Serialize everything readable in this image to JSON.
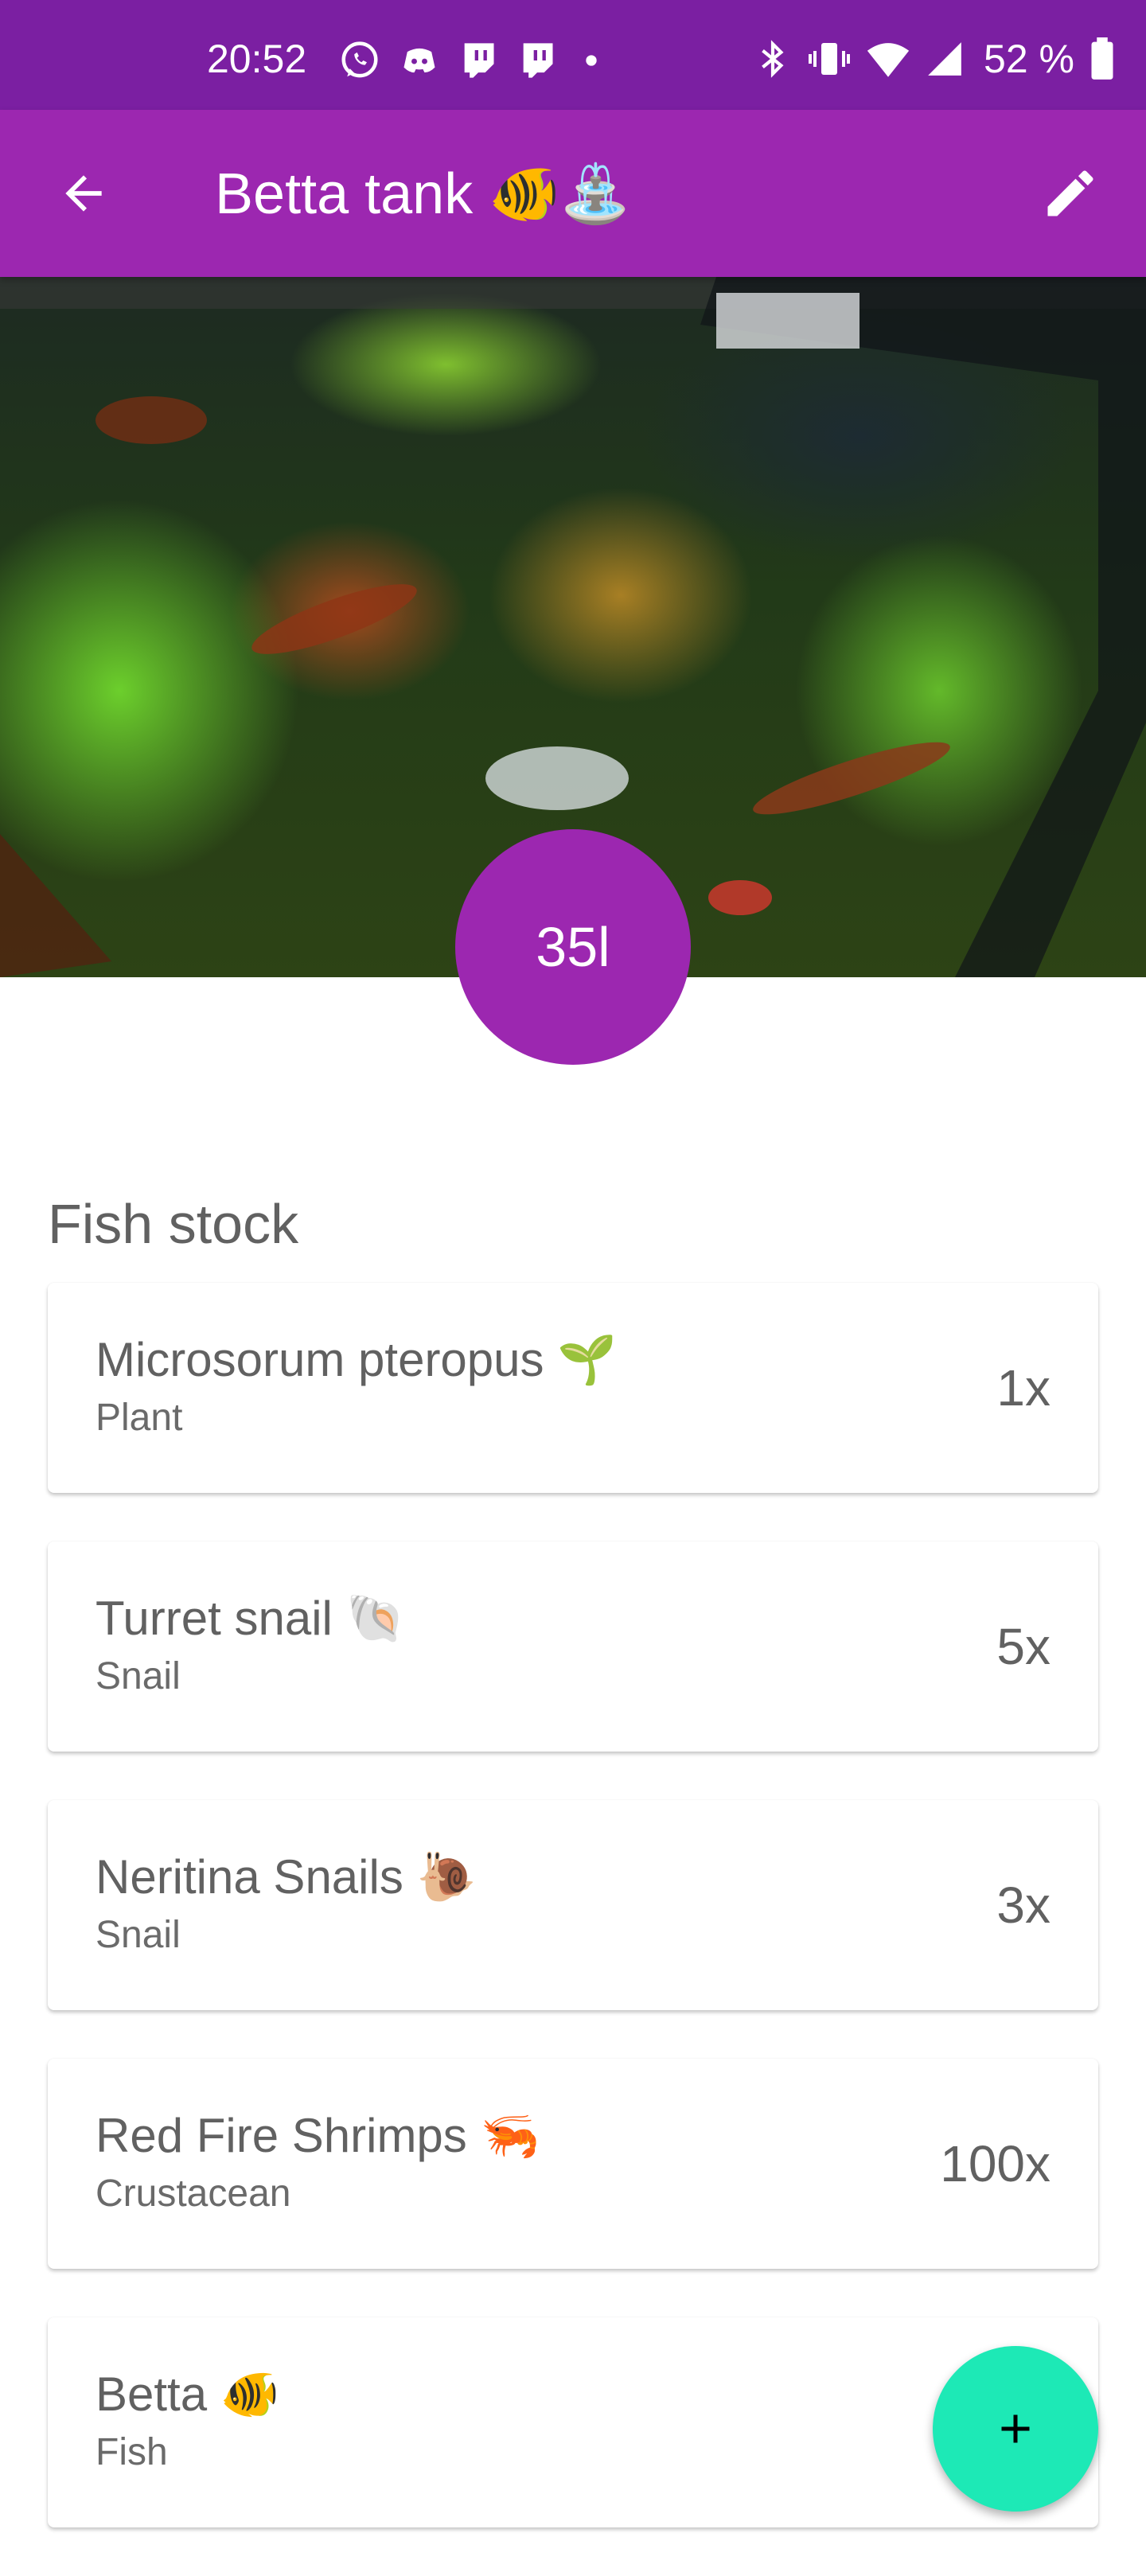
{
  "status_bar": {
    "time": "20:52",
    "battery_text": "52 %",
    "left_icons": [
      "whatsapp-icon",
      "discord-icon",
      "twitch-icon",
      "twitch-icon",
      "dot-icon"
    ],
    "right_icons": [
      "bluetooth-icon",
      "vibrate-icon",
      "wifi-icon",
      "signal-icon",
      "battery-icon"
    ]
  },
  "app_bar": {
    "title": "Betta tank 🐠⛲",
    "back_icon": "arrow-left-icon",
    "edit_icon": "pencil-icon"
  },
  "tank": {
    "volume": "35l"
  },
  "fish_stock": {
    "title": "Fish stock",
    "items": [
      {
        "name": "Microsorum pteropus 🌱",
        "type": "Plant",
        "quantity": "1x"
      },
      {
        "name": "Turret snail 🐚",
        "type": "Snail",
        "quantity": "5x"
      },
      {
        "name": "Neritina Snails 🐌",
        "type": "Snail",
        "quantity": "3x"
      },
      {
        "name": "Red Fire Shrimps 🦐",
        "type": "Crustacean",
        "quantity": "100x"
      },
      {
        "name": "Betta 🐠",
        "type": "Fish",
        "quantity": ""
      }
    ]
  },
  "fab": {
    "icon": "plus-icon"
  },
  "colors": {
    "status_bar": "#7b1fa2",
    "primary": "#9c27b0",
    "accent": "#1de9b6"
  }
}
